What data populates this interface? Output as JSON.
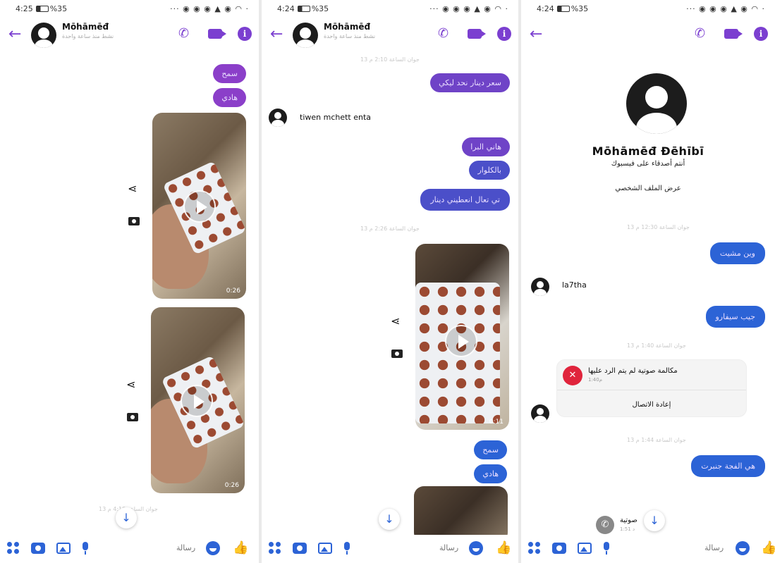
{
  "panels": [
    {
      "status": {
        "time": "4:25",
        "battery": "%35",
        "right_icons": "··· ◉ ◉ ◉ ▲ ◉ ◠ ·"
      },
      "header": {
        "name": "Mōhāmēđ",
        "subtitle": "نشط منذ ساعة واحدة"
      },
      "messages": [
        "سمح",
        "هادي"
      ],
      "video_durations": [
        "0:26",
        "0:26"
      ],
      "timestamp": "13 جوان الساعة 4:10 م",
      "composer": {
        "placeholder": "رسالة"
      }
    },
    {
      "status": {
        "time": "4:24",
        "battery": "%35",
        "right_icons": "··· ◉ ◉ ◉ ▲ ◉ ◠ ·"
      },
      "header": {
        "name": "Mōhāmēđ",
        "subtitle": "نشط منذ ساعة واحدة"
      },
      "timestamp_top": "13 جوان الساعة 2:10 م",
      "messages": [
        "سعر دينار نحد ليكي",
        "هاني البرا",
        "بالكلوار",
        "تي تعال انعطيني دينار",
        "سمح",
        "هادي"
      ],
      "incoming": "tiwen mchett enta",
      "timestamp_mid": "13 جوان الساعة 2:26 م",
      "video_duration": "0:11",
      "composer": {
        "placeholder": "رسالة"
      }
    },
    {
      "status": {
        "time": "4:24",
        "battery": "%35",
        "right_icons": "··· ◉ ◉ ◉ ▲ ◉ ◠ ·"
      },
      "profile": {
        "name": "Mōhāmēđ Đēhībī",
        "friends": "أنتم أصدقاء على فيسبوك",
        "view_profile": "عرض الملف الشخصي"
      },
      "timestamps": [
        "13 جوان الساعة 12:30 م",
        "13 جوان الساعة 1:40 م",
        "13 جوان الساعة 1:44 م"
      ],
      "messages": [
        "وين مشيت",
        "جيب سيفارو",
        "هي الفجة جنبرت"
      ],
      "incoming": "la7tha",
      "call": {
        "title": "مكالمة صوتية لم يتم الرد عليها",
        "sub": "1:40م",
        "callback": "إعادة الاتصال"
      },
      "voice": {
        "label": "صوتية",
        "sub": "1:51 د"
      },
      "composer": {
        "placeholder": "رسالة"
      }
    }
  ],
  "colors": {
    "accent": "#7b3fd0",
    "blue": "#2c63d6",
    "missed_call": "#e0243c"
  }
}
